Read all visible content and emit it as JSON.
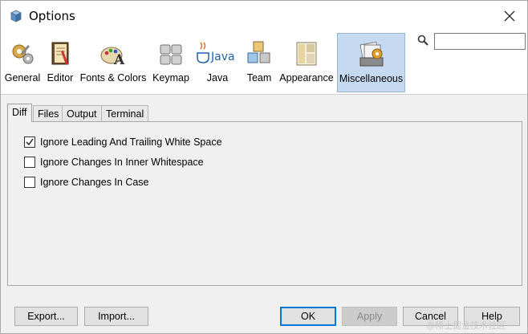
{
  "window": {
    "title": "Options"
  },
  "categories": [
    {
      "label": "General",
      "icon": "general-gears-icon",
      "selected": false
    },
    {
      "label": "Editor",
      "icon": "editor-notebook-icon",
      "selected": false
    },
    {
      "label": "Fonts & Colors",
      "icon": "fonts-colors-icon",
      "selected": false
    },
    {
      "label": "Keymap",
      "icon": "keymap-keyboard-icon",
      "selected": false
    },
    {
      "label": "Java",
      "icon": "java-logo-icon",
      "selected": false
    },
    {
      "label": "Team",
      "icon": "team-cubes-icon",
      "selected": false
    },
    {
      "label": "Appearance",
      "icon": "appearance-layout-icon",
      "selected": false
    },
    {
      "label": "Miscellaneous",
      "icon": "miscellaneous-folder-icon",
      "selected": true
    }
  ],
  "java_logo_text": "Java",
  "search": {
    "value": "",
    "placeholder": ""
  },
  "tabs": [
    {
      "label": "Diff",
      "active": true
    },
    {
      "label": "Files",
      "active": false
    },
    {
      "label": "Output",
      "active": false
    },
    {
      "label": "Terminal",
      "active": false
    }
  ],
  "diff_options": [
    {
      "label": "Ignore Leading And Trailing White Space",
      "checked": true
    },
    {
      "label": "Ignore Changes In Inner Whitespace",
      "checked": false
    },
    {
      "label": "Ignore Changes In Case",
      "checked": false
    }
  ],
  "buttons": {
    "export": "Export...",
    "import": "Import...",
    "ok": "OK",
    "apply": "Apply",
    "cancel": "Cancel",
    "help": "Help"
  },
  "watermark": "@稀土掘金技术社区",
  "colors": {
    "selected_bg": "#c5d9f1",
    "default_border": "#0078d7"
  }
}
